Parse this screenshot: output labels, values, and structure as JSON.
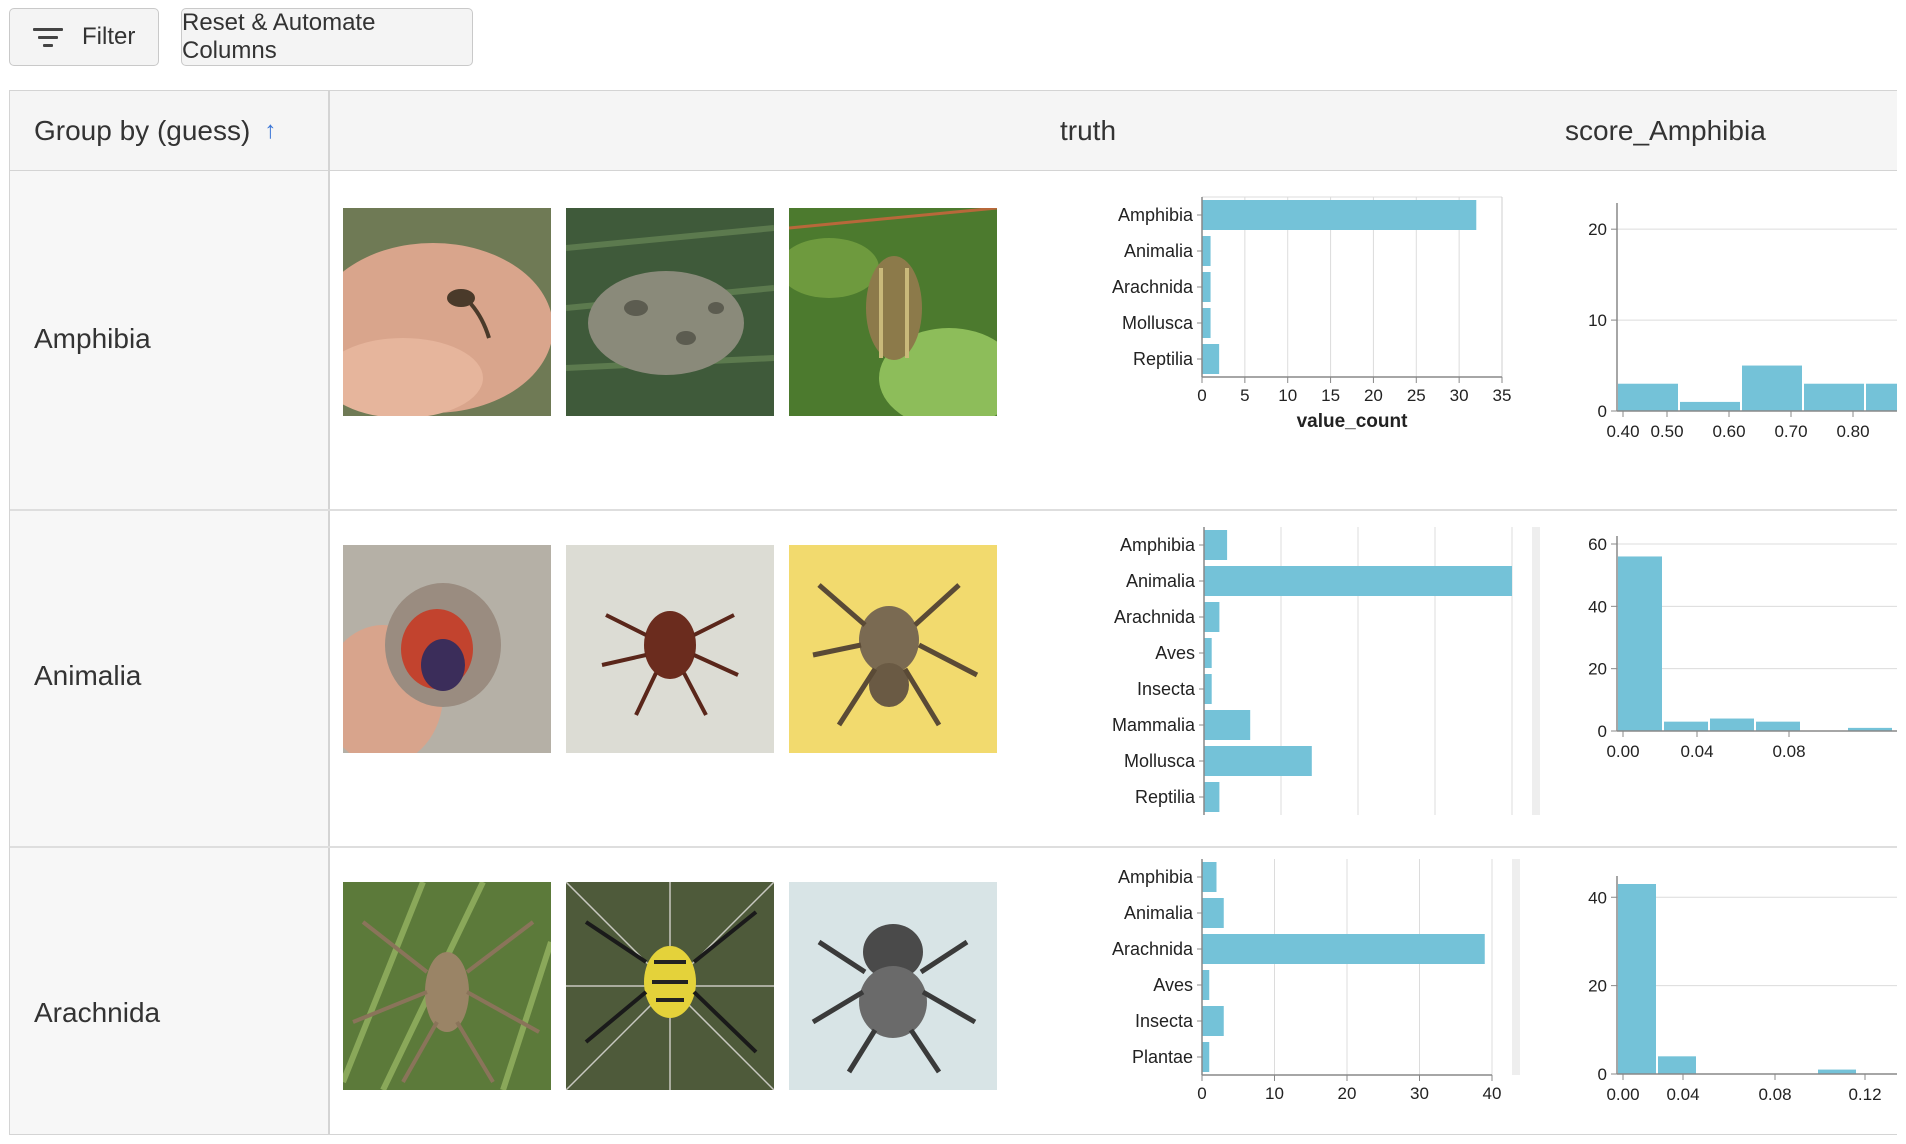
{
  "toolbar": {
    "filter_label": "Filter",
    "reset_label": "Reset & Automate Columns"
  },
  "table": {
    "headers": {
      "group": "Group by (guess)",
      "truth": "truth",
      "score": "score_Amphibia"
    },
    "rows": [
      {
        "label": "Amphibia"
      },
      {
        "label": "Animalia"
      },
      {
        "label": "Arachnida"
      }
    ]
  },
  "colors": {
    "bar": "#74c2d8",
    "sort_arrow": "#3b76d6",
    "header_bg": "#f5f5f5"
  },
  "icons": [
    "filter-icon",
    "sort-ascending-icon"
  ],
  "chart_data": [
    {
      "type": "bar",
      "orientation": "horizontal",
      "row": "Amphibia",
      "column": "truth",
      "categories": [
        "Amphibia",
        "Animalia",
        "Arachnida",
        "Mollusca",
        "Reptilia"
      ],
      "values": [
        32,
        1,
        1,
        1,
        2
      ],
      "xlabel": "value_count",
      "xlim": [
        0,
        35
      ],
      "xticks": [
        0,
        5,
        10,
        15,
        20,
        25,
        30,
        35
      ],
      "grid": true
    },
    {
      "type": "bar",
      "subtype": "histogram",
      "row": "Amphibia",
      "column": "score_Amphibia",
      "bins": [
        [
          0.35,
          0.45
        ],
        [
          0.45,
          0.55
        ],
        [
          0.55,
          0.65
        ],
        [
          0.65,
          0.75
        ],
        [
          0.75,
          0.85
        ]
      ],
      "values": [
        3,
        1,
        5,
        3,
        3
      ],
      "ylim": [
        0,
        22
      ],
      "yticks": [
        0,
        10,
        20
      ],
      "xticks": [
        "0.40",
        "0.50",
        "0.60",
        "0.70",
        "0.80"
      ],
      "grid": true
    },
    {
      "type": "bar",
      "orientation": "horizontal",
      "row": "Animalia",
      "column": "truth",
      "categories": [
        "Amphibia",
        "Animalia",
        "Arachnida",
        "Aves",
        "Insecta",
        "Mammalia",
        "Mollusca",
        "Reptilia"
      ],
      "values": [
        3,
        40,
        2,
        1,
        1,
        6,
        14,
        2
      ],
      "xlim": [
        0,
        40
      ],
      "grid": true
    },
    {
      "type": "bar",
      "subtype": "histogram",
      "row": "Animalia",
      "column": "score_Amphibia",
      "bins": [
        [
          0.0,
          0.02
        ],
        [
          0.02,
          0.04
        ],
        [
          0.04,
          0.06
        ],
        [
          0.06,
          0.08
        ],
        [
          0.08,
          0.1
        ],
        [
          0.1,
          0.12
        ]
      ],
      "values": [
        56,
        3,
        4,
        3,
        0,
        1
      ],
      "ylim": [
        0,
        60
      ],
      "yticks": [
        0,
        20,
        40,
        60
      ],
      "xticks": [
        "0.00",
        "0.04",
        "0.08"
      ],
      "grid": true
    },
    {
      "type": "bar",
      "orientation": "horizontal",
      "row": "Arachnida",
      "column": "truth",
      "categories": [
        "Amphibia",
        "Animalia",
        "Arachnida",
        "Aves",
        "Insecta",
        "Plantae"
      ],
      "values": [
        2,
        3,
        39,
        1,
        3,
        1
      ],
      "xlim": [
        0,
        40
      ],
      "xticks": [
        0,
        10,
        20,
        30,
        40
      ],
      "grid": true
    },
    {
      "type": "bar",
      "subtype": "histogram",
      "row": "Arachnida",
      "column": "score_Amphibia",
      "bins": [
        [
          0.0,
          0.02
        ],
        [
          0.02,
          0.04
        ],
        [
          0.04,
          0.06
        ],
        [
          0.06,
          0.08
        ],
        [
          0.08,
          0.1
        ],
        [
          0.1,
          0.12
        ]
      ],
      "values": [
        43,
        4,
        0,
        0,
        0,
        1
      ],
      "ylim": [
        0,
        43
      ],
      "yticks": [
        0,
        20,
        40
      ],
      "xticks": [
        "0.00",
        "0.04",
        "0.08",
        "0.12"
      ],
      "grid": true
    }
  ]
}
